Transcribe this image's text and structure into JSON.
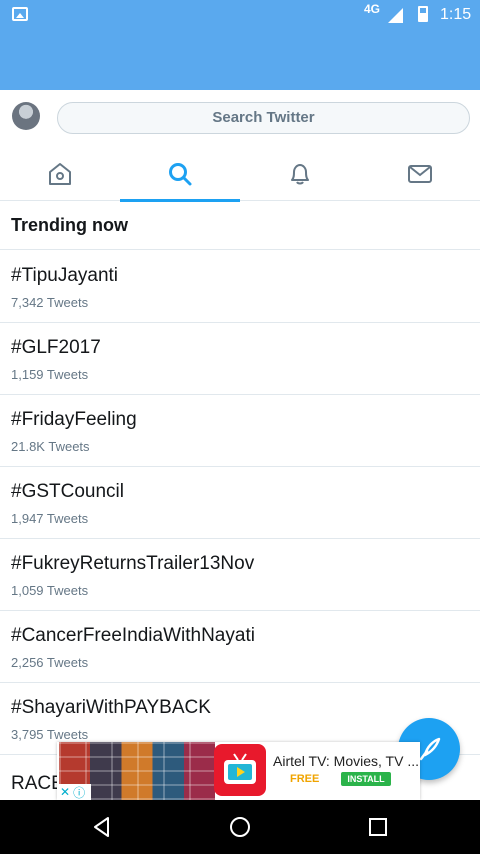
{
  "status_bar": {
    "network": "4G",
    "time": "1:15"
  },
  "search": {
    "placeholder": "Search Twitter"
  },
  "tabs": [
    {
      "name": "home",
      "icon": "home-icon"
    },
    {
      "name": "search",
      "icon": "search-icon",
      "active": true
    },
    {
      "name": "notifications",
      "icon": "bell-icon"
    },
    {
      "name": "messages",
      "icon": "mail-icon"
    }
  ],
  "colors": {
    "brand": "#5aa9ee",
    "accent": "#1da1f2",
    "secondary_text": "#657786",
    "divider": "#e1e8ed"
  },
  "section": {
    "title": "Trending now"
  },
  "trends": [
    {
      "name": "#TipuJayanti",
      "count": "7,342 Tweets"
    },
    {
      "name": "#GLF2017",
      "count": "1,159 Tweets"
    },
    {
      "name": "#FridayFeeling",
      "count": "21.8K Tweets"
    },
    {
      "name": "#GSTCouncil",
      "count": "1,947 Tweets"
    },
    {
      "name": "#FukreyReturnsTrailer13Nov",
      "count": "1,059 Tweets"
    },
    {
      "name": "#CancerFreeIndiaWithNayati",
      "count": "2,256 Tweets"
    },
    {
      "name": "#ShayariWithPAYBACK",
      "count": "3,795 Tweets"
    },
    {
      "name": "RACE"
    }
  ],
  "ad": {
    "title": "Airtel TV: Movies, TV ...",
    "price": "FREE",
    "install_label": "INSTALL"
  }
}
